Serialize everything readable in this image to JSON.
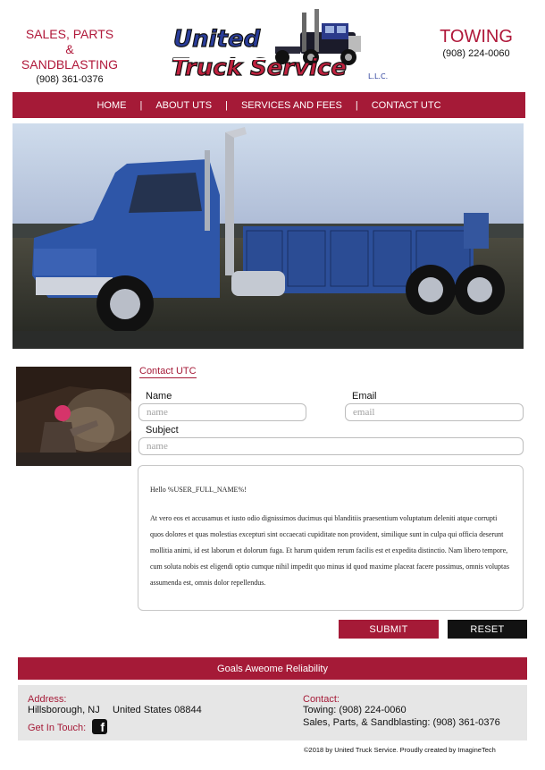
{
  "header": {
    "left_title_line1": "SALES, PARTS",
    "left_title_line2": "& SANDBLASTING",
    "left_phone": "(908) 361-0376",
    "logo_text_line1": "United",
    "logo_text_line2": "Truck Service",
    "logo_suffix": "L.L.C.",
    "right_title": "TOWING",
    "right_phone": "(908) 224-0060"
  },
  "nav": {
    "items": [
      "HOME",
      "ABOUT UTS",
      "SERVICES AND FEES",
      "CONTACT UTC"
    ],
    "separator": "|"
  },
  "form": {
    "title": "Contact UTC",
    "name_label": "Name",
    "name_placeholder": "name",
    "email_label": "Email",
    "email_placeholder": "email",
    "subject_label": "Subject",
    "subject_placeholder": "name",
    "message_greeting": "Hello %USER_FULL_NAME%!",
    "message_body": "At vero eos et accusamus et iusto odio dignissimos ducimus qui blanditiis praesentium voluptatum deleniti atque corrupti quos dolores et quas molestias excepturi sint occaecati cupiditate non provident, similique sunt in culpa qui officia deserunt mollitia animi, id est laborum et dolorum fuga. Et harum quidem rerum facilis est et expedita distinctio. Nam libero tempore, cum soluta nobis est eligendi optio cumque nihil impedit quo minus id quod maxime placeat facere possimus, omnis voluptas assumenda est, omnis dolor repellendus.",
    "submit_label": "SUBMIT",
    "reset_label": "RESET"
  },
  "goals": "Goals  Aweome Reliability",
  "footer": {
    "address_label": "Address:",
    "address_city": "Hillsborough, NJ",
    "address_country": "United States 08844",
    "get_in_touch": "Get In Touch:",
    "facebook_glyph": "f",
    "contact_label": "Contact:",
    "towing": "Towing: (908) 224-0060",
    "sales": "Sales, Parts, & Sandblasting: (908) 361-0376"
  },
  "copyright": "©2018 by United Truck Service. Proudly created by ImagineTech",
  "colors": {
    "brand_red": "#a51a37",
    "dark": "#121212",
    "footer_gray": "#e6e6e6"
  }
}
